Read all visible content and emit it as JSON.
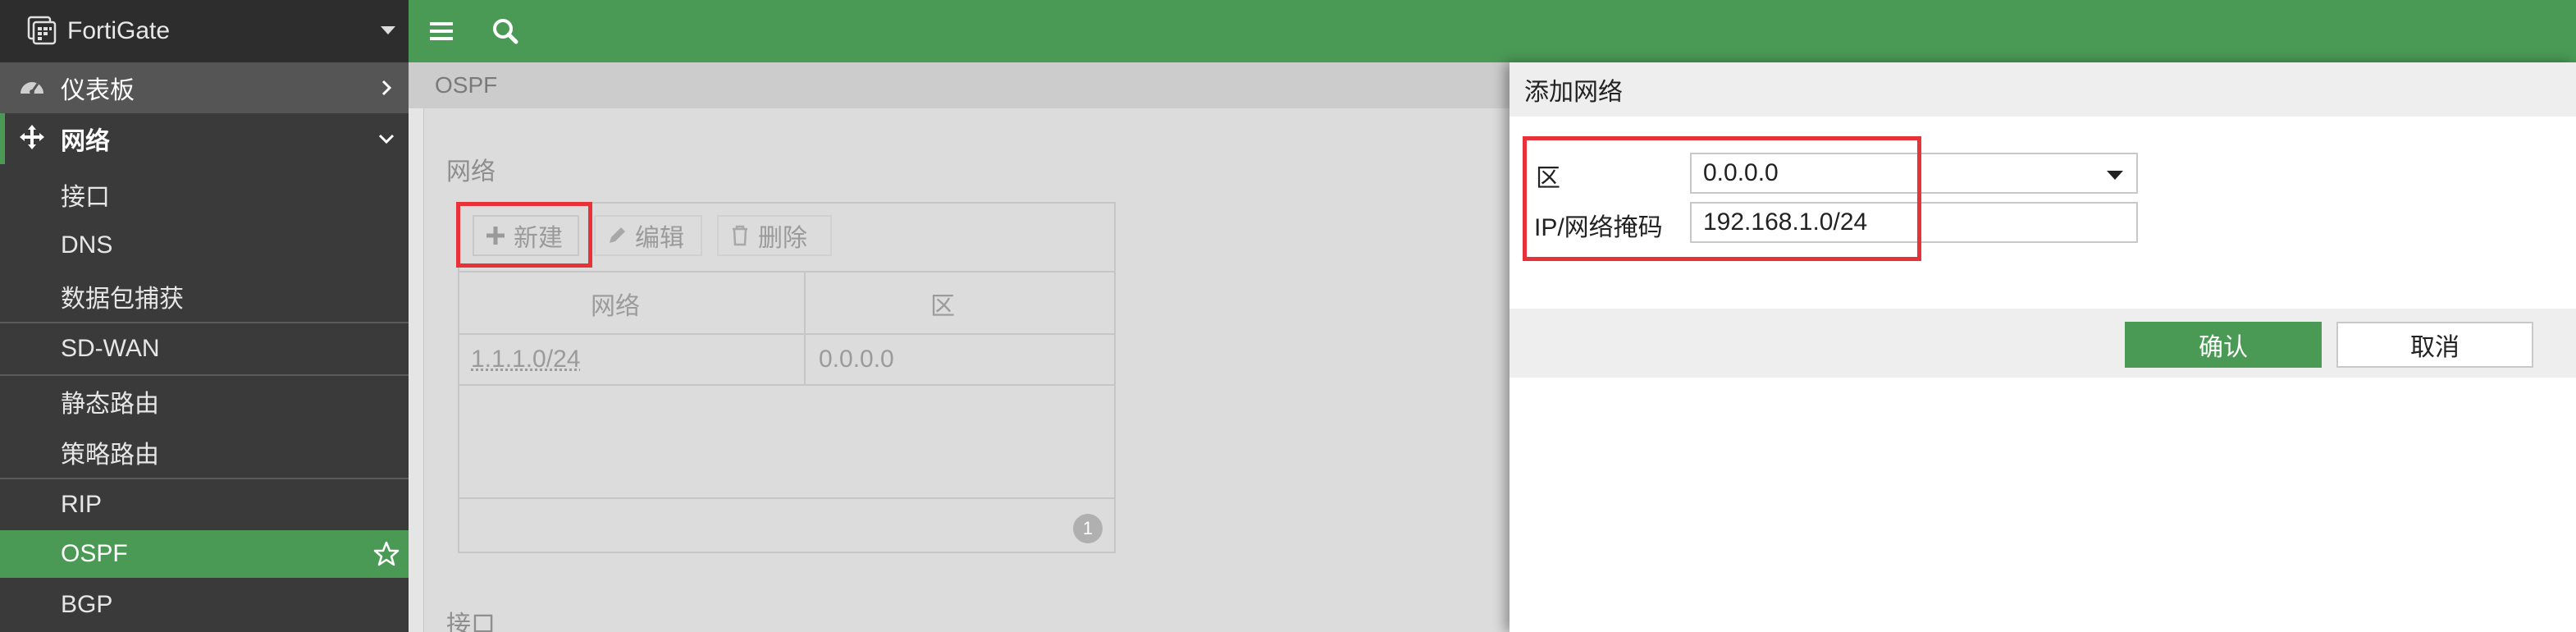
{
  "sidebar": {
    "brand": "FortiGate",
    "sections": [
      {
        "label": "仪表板",
        "icon": "dashboard-icon",
        "chevron": "right"
      },
      {
        "label": "网络",
        "icon": "network-move-icon",
        "chevron": "down"
      }
    ],
    "items": [
      {
        "label": "接口"
      },
      {
        "label": "DNS"
      },
      {
        "label": "数据包捕获"
      },
      {
        "label": "SD-WAN"
      },
      {
        "label": "静态路由"
      },
      {
        "label": "策略路由"
      },
      {
        "label": "RIP"
      },
      {
        "label": "OSPF",
        "active": true
      },
      {
        "label": "BGP"
      }
    ]
  },
  "topbar": {
    "menu_icon": "hamburger-icon",
    "search_icon": "search-icon"
  },
  "breadcrumb": "OSPF",
  "panel": {
    "section_networks": "网络",
    "toolbar": {
      "new": "新建",
      "edit": "编辑",
      "delete": "删除"
    },
    "columns": [
      "网络",
      "区"
    ],
    "rows": [
      {
        "network": "1.1.1.0/24",
        "area": "0.0.0.0"
      }
    ],
    "page_count": "1",
    "section_interfaces": "接口"
  },
  "modal": {
    "title": "添加网络",
    "area_label": "区",
    "area_value": "0.0.0.0",
    "ipmask_label": "IP/网络掩码",
    "ipmask_value": "192.168.1.0/24",
    "ok": "确认",
    "cancel": "取消"
  },
  "colors": {
    "accent": "#4a9a55",
    "highlight": "#e8323a",
    "sidebar": "#3a3a3a"
  }
}
